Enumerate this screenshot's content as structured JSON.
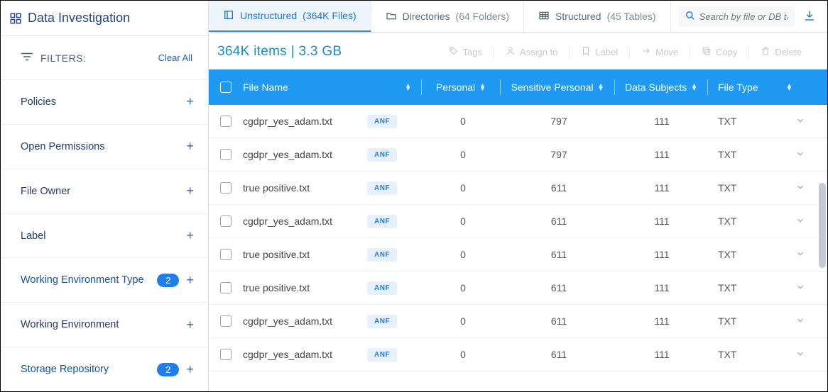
{
  "header": {
    "title": "Data Investigation"
  },
  "filters": {
    "heading": "FILTERS:",
    "clear_all": "Clear All",
    "items": [
      {
        "label": "Policies",
        "count": null,
        "active": false
      },
      {
        "label": "Open Permissions",
        "count": null,
        "active": false
      },
      {
        "label": "File Owner",
        "count": null,
        "active": false
      },
      {
        "label": "Label",
        "count": null,
        "active": false
      },
      {
        "label": "Working Environment Type",
        "count": "2",
        "active": true
      },
      {
        "label": "Working Environment",
        "count": null,
        "active": false
      },
      {
        "label": "Storage Repository",
        "count": "2",
        "active": true
      }
    ]
  },
  "tabs": [
    {
      "label": "Unstructured",
      "count": "(364K Files)",
      "active": true
    },
    {
      "label": "Directories",
      "count": "(64 Folders)",
      "active": false
    },
    {
      "label": "Structured",
      "count": "(45 Tables)",
      "active": false
    }
  ],
  "search": {
    "placeholder": "Search by file or DB table"
  },
  "summary": "364K items  |  3.3 GB",
  "actions": {
    "tags": "Tags",
    "assign": "Assign to",
    "label": "Label",
    "move": "Move",
    "copy": "Copy",
    "delete": "Delete"
  },
  "columns": {
    "file_name": "File Name",
    "personal": "Personal",
    "sensitive": "Sensitive Personal",
    "subjects": "Data Subjects",
    "file_type": "File Type"
  },
  "rows": [
    {
      "name": "cgdpr_yes_adam.txt",
      "tag": "ANF",
      "personal": "0",
      "sensitive": "797",
      "subjects": "111",
      "type": "TXT"
    },
    {
      "name": "cgdpr_yes_adam.txt",
      "tag": "ANF",
      "personal": "0",
      "sensitive": "797",
      "subjects": "111",
      "type": "TXT"
    },
    {
      "name": "true positive.txt",
      "tag": "ANF",
      "personal": "0",
      "sensitive": "611",
      "subjects": "111",
      "type": "TXT"
    },
    {
      "name": "cgdpr_yes_adam.txt",
      "tag": "ANF",
      "personal": "0",
      "sensitive": "611",
      "subjects": "111",
      "type": "TXT"
    },
    {
      "name": "true positive.txt",
      "tag": "ANF",
      "personal": "0",
      "sensitive": "611",
      "subjects": "111",
      "type": "TXT"
    },
    {
      "name": "true positive.txt",
      "tag": "ANF",
      "personal": "0",
      "sensitive": "611",
      "subjects": "111",
      "type": "TXT"
    },
    {
      "name": "cgdpr_yes_adam.txt",
      "tag": "ANF",
      "personal": "0",
      "sensitive": "611",
      "subjects": "111",
      "type": "TXT"
    },
    {
      "name": "cgdpr_yes_adam.txt",
      "tag": "ANF",
      "personal": "0",
      "sensitive": "611",
      "subjects": "111",
      "type": "TXT"
    }
  ]
}
